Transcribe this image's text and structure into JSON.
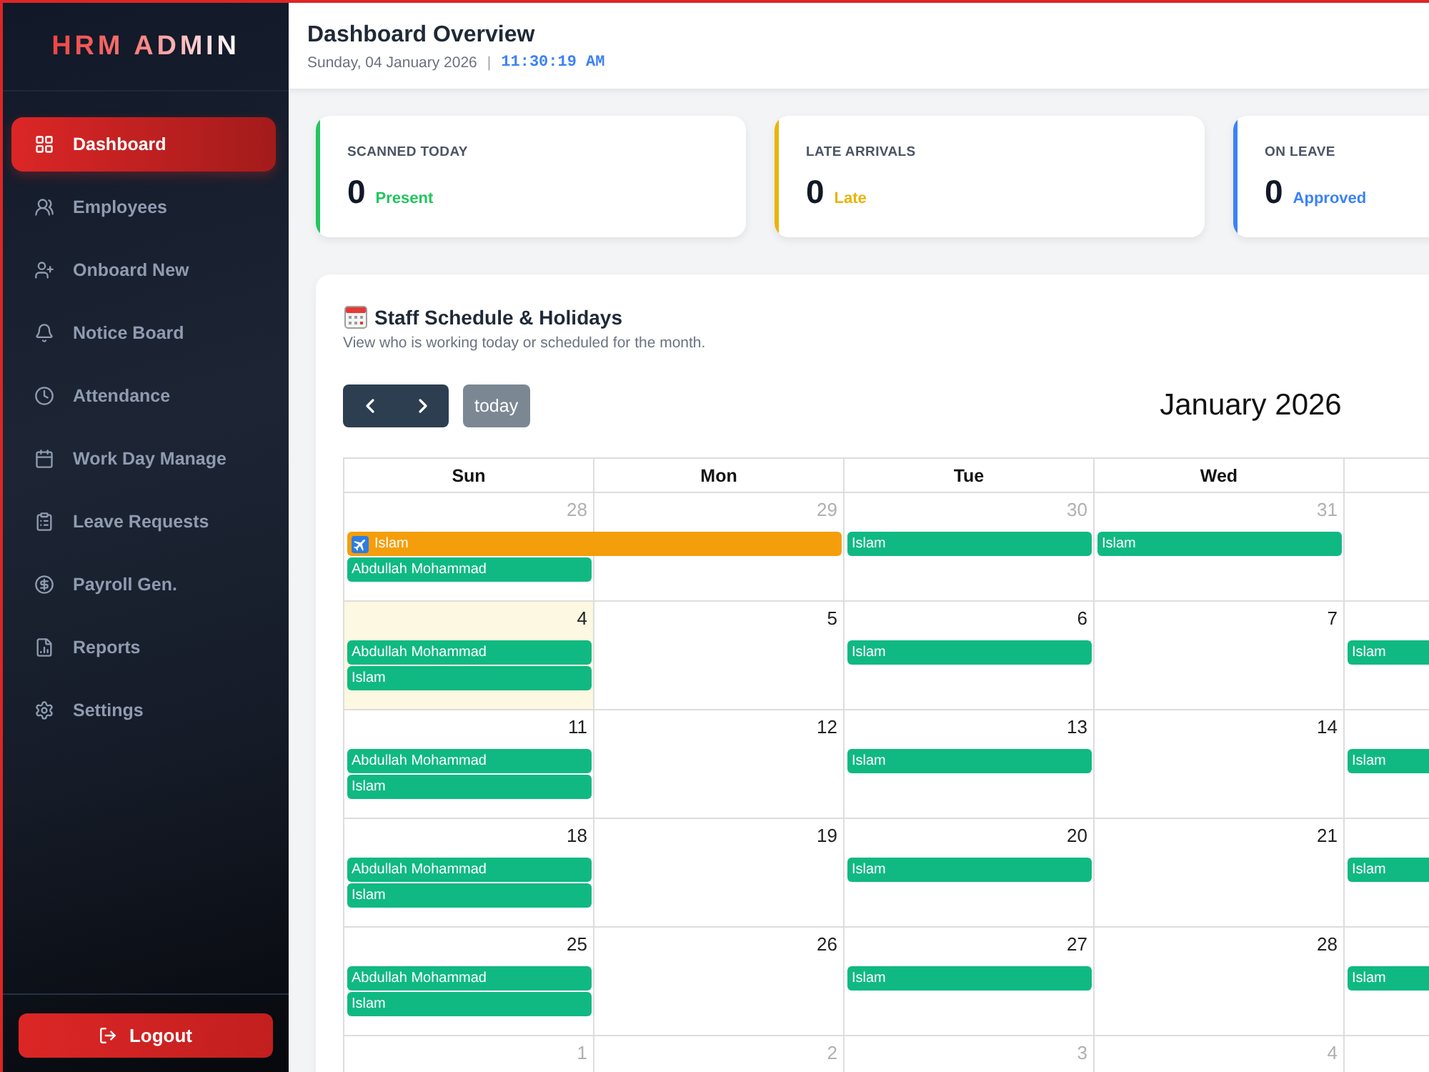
{
  "sidebar": {
    "logo": "HRM ADMIN",
    "items": [
      {
        "label": "Dashboard",
        "selected": true
      },
      {
        "label": "Employees",
        "selected": false
      },
      {
        "label": "Onboard New",
        "selected": false
      },
      {
        "label": "Notice Board",
        "selected": false
      },
      {
        "label": "Attendance",
        "selected": false
      },
      {
        "label": "Work Day Manage",
        "selected": false
      },
      {
        "label": "Leave Requests",
        "selected": false
      },
      {
        "label": "Payroll Gen.",
        "selected": false
      },
      {
        "label": "Reports",
        "selected": false
      },
      {
        "label": "Settings",
        "selected": false
      }
    ],
    "logout": "Logout"
  },
  "header": {
    "title": "Dashboard Overview",
    "date": "Sunday, 04 January 2026",
    "separator": "|",
    "clock": "11:30:19 AM"
  },
  "stats": [
    {
      "label": "SCANNED TODAY",
      "value": "0",
      "note": "Present",
      "color": "#22c55e"
    },
    {
      "label": "LATE ARRIVALS",
      "value": "0",
      "note": "Late",
      "color": "#eab308"
    },
    {
      "label": "ON LEAVE",
      "value": "0",
      "note": "Approved",
      "color": "#3b82f6"
    }
  ],
  "schedule": {
    "title": "Staff Schedule & Holidays",
    "subtitle": "View who is working today or scheduled for the month.",
    "toolbar": {
      "today_button": {
        "label": "today",
        "disabled": true
      },
      "month": "January 2026"
    },
    "columns": [
      "Sun",
      "Mon",
      "Tue",
      "Wed"
    ],
    "weeks": [
      {
        "days": [
          {
            "number": "28",
            "other_month": true,
            "today": false,
            "events": [
              {
                "title": "Islam",
                "kind": "holiday",
                "color": "#f59e0b",
                "continues": true
              },
              {
                "title": "Abdullah Mohammad",
                "kind": "shift",
                "color": "#10b981",
                "continues": false
              }
            ]
          },
          {
            "number": "29",
            "other_month": true,
            "today": false
          },
          {
            "number": "30",
            "other_month": true,
            "today": false,
            "events": [
              {
                "title": "Islam",
                "kind": "shift",
                "color": "#10b981",
                "continues": false
              }
            ]
          },
          {
            "number": "31",
            "other_month": true,
            "today": false,
            "events": [
              {
                "title": "Islam",
                "kind": "shift",
                "color": "#10b981",
                "continues": false
              }
            ]
          }
        ]
      },
      {
        "days": [
          {
            "number": "4",
            "other_month": false,
            "today": true,
            "events": [
              {
                "title": "Abdullah Mohammad",
                "kind": "shift",
                "color": "#10b981",
                "continues": false
              },
              {
                "title": "Islam",
                "kind": "shift",
                "color": "#10b981",
                "continues": false
              }
            ]
          },
          {
            "number": "5",
            "other_month": false,
            "today": false
          },
          {
            "number": "6",
            "other_month": false,
            "today": false,
            "events": [
              {
                "title": "Islam",
                "kind": "shift",
                "color": "#10b981",
                "continues": false
              }
            ]
          },
          {
            "number": "7",
            "other_month": false,
            "today": false
          },
          {
            "today": false,
            "events": [
              {
                "title": "Islam",
                "kind": "shift",
                "color": "#10b981"
              }
            ]
          }
        ]
      },
      {
        "days": [
          {
            "number": "11",
            "other_month": false,
            "today": false,
            "events": [
              {
                "title": "Abdullah Mohammad",
                "kind": "shift",
                "color": "#10b981",
                "continues": false
              },
              {
                "title": "Islam",
                "kind": "shift",
                "color": "#10b981",
                "continues": false
              }
            ]
          },
          {
            "number": "12",
            "other_month": false,
            "today": false
          },
          {
            "number": "13",
            "other_month": false,
            "today": false,
            "events": [
              {
                "title": "Islam",
                "kind": "shift",
                "color": "#10b981",
                "continues": false
              }
            ]
          },
          {
            "number": "14",
            "other_month": false,
            "today": false
          },
          {
            "today": false,
            "events": [
              {
                "title": "Islam",
                "kind": "shift",
                "color": "#10b981"
              }
            ]
          }
        ]
      },
      {
        "days": [
          {
            "number": "18",
            "other_month": false,
            "today": false,
            "events": [
              {
                "title": "Abdullah Mohammad",
                "kind": "shift",
                "color": "#10b981",
                "continues": false
              },
              {
                "title": "Islam",
                "kind": "shift",
                "color": "#10b981",
                "continues": false
              }
            ]
          },
          {
            "number": "19",
            "other_month": false,
            "today": false
          },
          {
            "number": "20",
            "other_month": false,
            "today": false,
            "events": [
              {
                "title": "Islam",
                "kind": "shift",
                "color": "#10b981",
                "continues": false
              }
            ]
          },
          {
            "number": "21",
            "other_month": false,
            "today": false
          },
          {
            "today": false,
            "events": [
              {
                "title": "Islam",
                "kind": "shift",
                "color": "#10b981"
              }
            ]
          }
        ]
      },
      {
        "days": [
          {
            "number": "25",
            "other_month": false,
            "today": false,
            "events": [
              {
                "title": "Abdullah Mohammad",
                "kind": "shift",
                "color": "#10b981",
                "continues": false
              },
              {
                "title": "Islam",
                "kind": "shift",
                "color": "#10b981",
                "continues": false
              }
            ]
          },
          {
            "number": "26",
            "other_month": false,
            "today": false
          },
          {
            "number": "27",
            "other_month": false,
            "today": false,
            "events": [
              {
                "title": "Islam",
                "kind": "shift",
                "color": "#10b981",
                "continues": false
              }
            ]
          },
          {
            "number": "28",
            "other_month": false,
            "today": false
          },
          {
            "today": false,
            "events": [
              {
                "title": "Islam",
                "kind": "shift",
                "color": "#10b981"
              }
            ]
          }
        ]
      },
      {
        "days": [
          {
            "number": "1",
            "other_month": true,
            "today": false
          },
          {
            "number": "2",
            "other_month": true,
            "today": false
          },
          {
            "number": "3",
            "other_month": true,
            "today": false
          },
          {
            "number": "4",
            "other_month": true,
            "today": false
          }
        ]
      }
    ]
  }
}
